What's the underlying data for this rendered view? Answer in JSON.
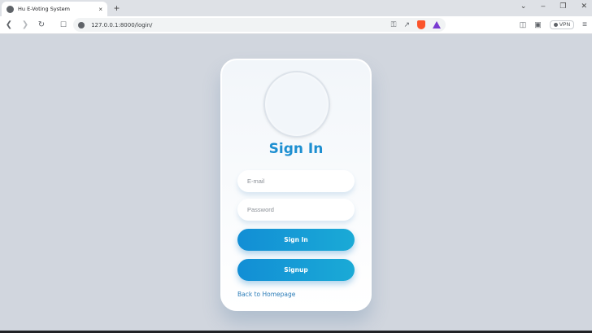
{
  "browser": {
    "tab_title": "Hu E-Voting System",
    "tab_close": "×",
    "new_tab": "+",
    "url": "127.0.0.1:8000/login/",
    "vpn_label": "VPN",
    "window_controls": [
      "⌄",
      "–",
      "❐",
      "✕"
    ]
  },
  "login": {
    "title": "Sign In",
    "email_placeholder": "E-mail",
    "password_placeholder": "Password",
    "signin_label": "Sign In",
    "signup_label": "Signup",
    "back_link": "Back to Homepage"
  },
  "colors": {
    "accent": "#1d8fd1",
    "button_start": "#128ed5",
    "button_end": "#1aaad6",
    "page_bg": "#d1d6de"
  }
}
